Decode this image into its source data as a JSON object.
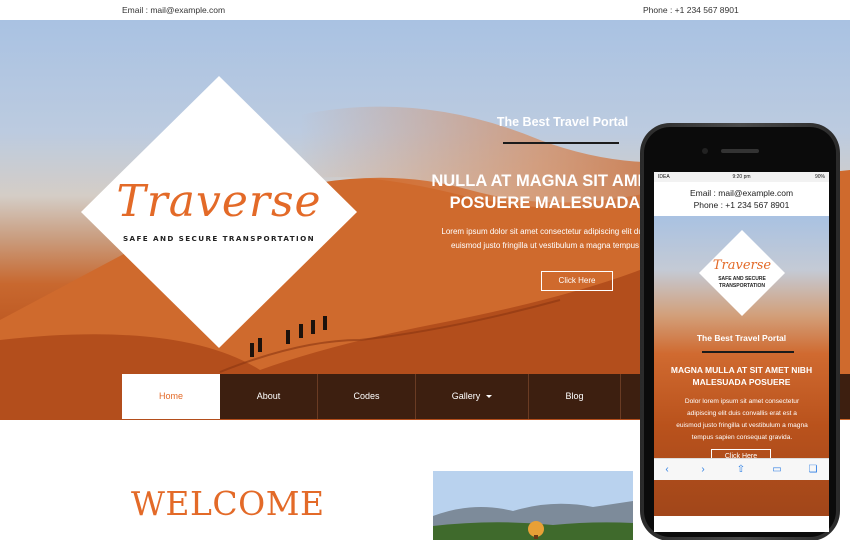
{
  "topbar": {
    "email": "Email : mail@example.com",
    "phone": "Phone : +1 234 567 8901"
  },
  "hero": {
    "logo": "Traverse",
    "tagline": "SAFE AND SECURE TRANSPORTATION",
    "portal_title": "The Best Travel Portal",
    "headline_line1": "NULLA AT MAGNA SIT AMET",
    "headline_line2": "POSUERE MALESUADA",
    "description_line1": "Lorem ipsum dolor sit amet consectetur adipiscing elit duis",
    "description_line2": "euismod justo fringilla ut vestibulum a magna tempus",
    "button_label": "Click Here"
  },
  "nav": {
    "items": [
      {
        "label": "Home"
      },
      {
        "label": "About"
      },
      {
        "label": "Codes"
      },
      {
        "label": "Gallery"
      },
      {
        "label": "Blog"
      }
    ]
  },
  "welcome": {
    "title": "WELCOME"
  },
  "mobile": {
    "status": {
      "carrier": "IDEA",
      "time": "9:20 pm",
      "battery": "90%"
    },
    "email": "Email : mail@example.com",
    "phone": "Phone : +1 234 567 8901",
    "logo": "Traverse",
    "tag_line1": "SAFE AND SECURE",
    "tag_line2": "TRANSPORTATION",
    "portal_title": "The Best Travel Portal",
    "headline_line1": "MAGNA MULLA AT SIT AMET NIBH",
    "headline_line2": "MALESUADA POSUERE",
    "desc_line1": "Dolor lorem ipsum sit amet consectetur",
    "desc_line2": "adipiscing elit duis convallis erat est a",
    "desc_line3": "euismod justo fringilla ut vestibulum a magna",
    "desc_line4": "tempus sapien consequat gravida.",
    "button_label": "Click Here",
    "toolbar_icons": [
      "back-arrow-icon",
      "forward-arrow-icon",
      "share-icon",
      "bookmarks-icon",
      "tabs-icon"
    ]
  },
  "colors": {
    "accent": "#e36a28",
    "nav_bg": "#3d1f10",
    "sky": "#a9c2e2",
    "sand": "#c8682f"
  }
}
